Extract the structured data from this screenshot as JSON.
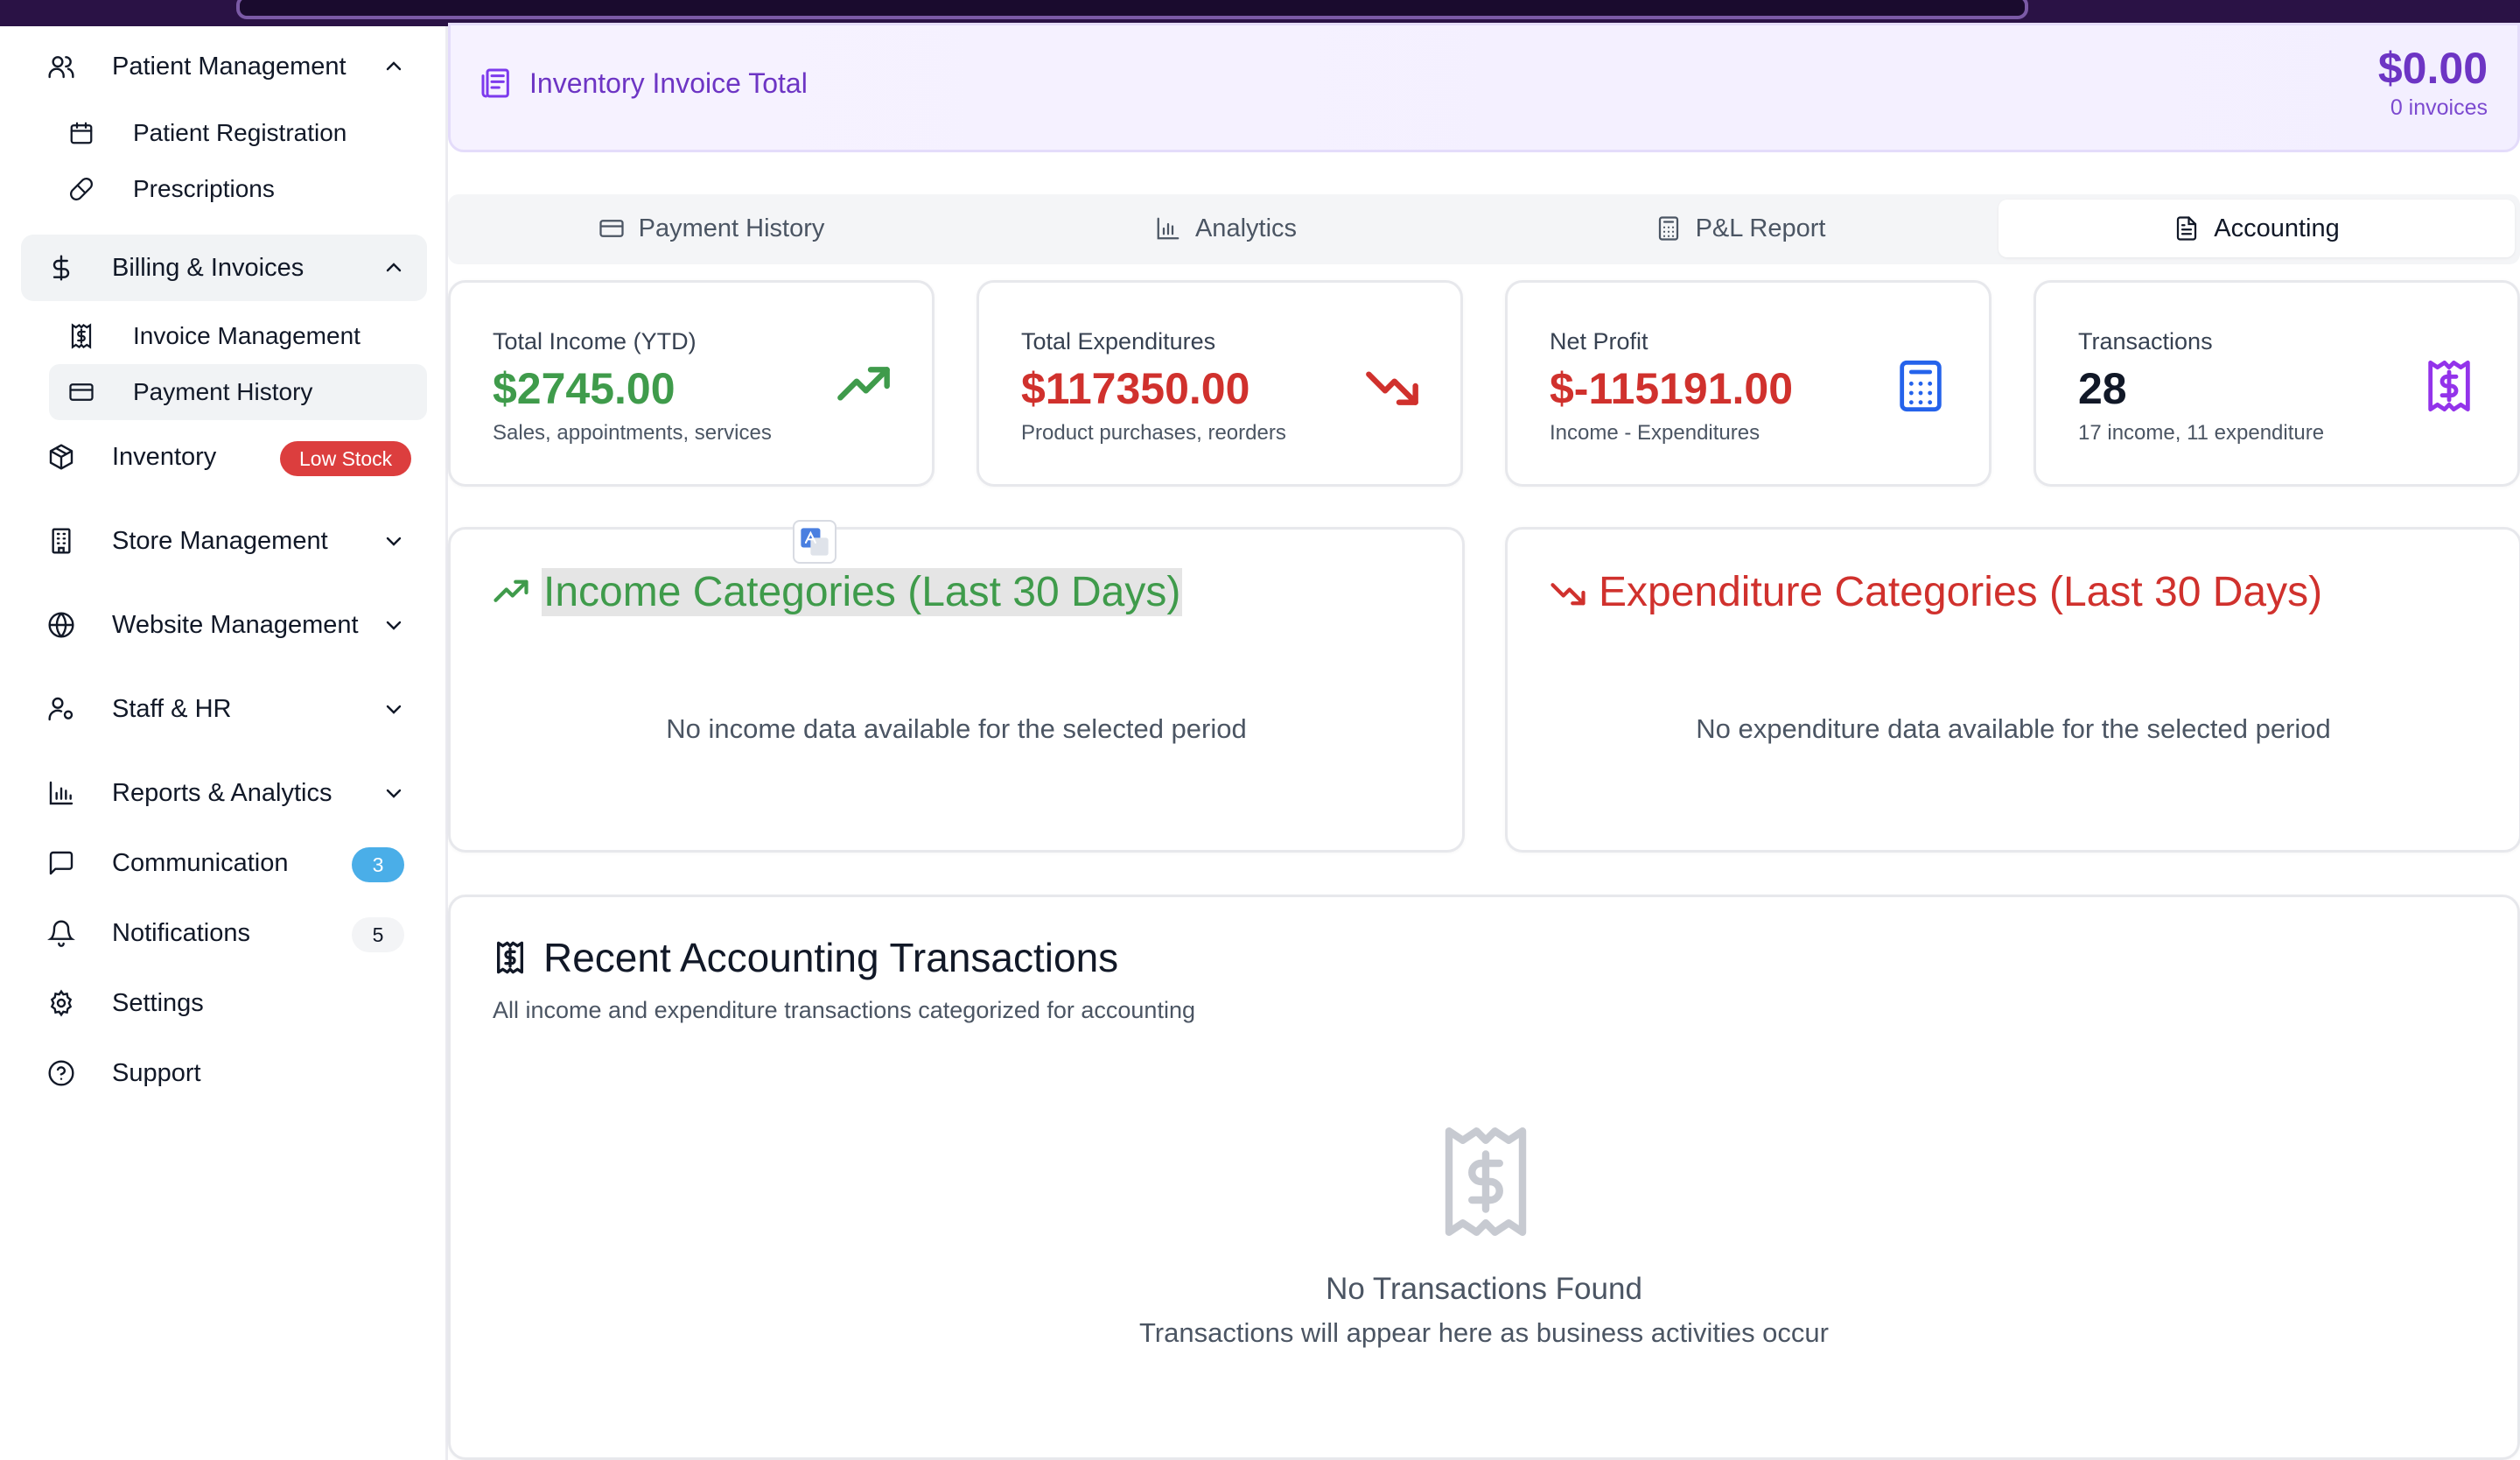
{
  "sidebar": {
    "items": [
      {
        "label": "Patient Management",
        "icon": "users-icon"
      },
      {
        "label": "Patient Registration",
        "icon": "calendar-icon"
      },
      {
        "label": "Prescriptions",
        "icon": "pill-icon"
      },
      {
        "label": "Billing & Invoices",
        "icon": "dollar-icon"
      },
      {
        "label": "Invoice Management",
        "icon": "receipt-icon"
      },
      {
        "label": "Payment History",
        "icon": "credit-card-icon"
      },
      {
        "label": "Inventory",
        "icon": "package-icon",
        "badge": "Low Stock"
      },
      {
        "label": "Store Management",
        "icon": "building-icon"
      },
      {
        "label": "Website Management",
        "icon": "globe-icon"
      },
      {
        "label": "Staff & HR",
        "icon": "user-cog-icon"
      },
      {
        "label": "Reports & Analytics",
        "icon": "bar-chart-icon"
      },
      {
        "label": "Communication",
        "icon": "message-icon",
        "badge": "3"
      },
      {
        "label": "Notifications",
        "icon": "bell-icon",
        "badge": "5"
      },
      {
        "label": "Settings",
        "icon": "gear-icon"
      },
      {
        "label": "Support",
        "icon": "help-circle-icon"
      }
    ]
  },
  "inventory_banner": {
    "title": "Inventory Invoice Total",
    "amount": "$0.00",
    "count": "0 invoices"
  },
  "tabs": [
    {
      "label": "Payment History",
      "icon": "credit-card-icon"
    },
    {
      "label": "Analytics",
      "icon": "bar-chart-icon"
    },
    {
      "label": "P&L Report",
      "icon": "calculator-icon"
    },
    {
      "label": "Accounting",
      "icon": "file-text-icon",
      "active": true
    }
  ],
  "stats": [
    {
      "label": "Total Income (YTD)",
      "value": "$2745.00",
      "sub": "Sales, appointments, services",
      "icon": "trending-up-icon",
      "color": "#3f9b4b"
    },
    {
      "label": "Total Expenditures",
      "value": "$117350.00",
      "sub": "Product purchases, reorders",
      "icon": "trending-down-icon",
      "color": "#d0312d"
    },
    {
      "label": "Net Profit",
      "value": "$-115191.00",
      "sub": "Income - Expenditures",
      "icon": "calculator-icon",
      "color": "#d0312d"
    },
    {
      "label": "Transactions",
      "value": "28",
      "sub": "17 income, 11 expenditure",
      "icon": "receipt-icon",
      "color": "#111827"
    }
  ],
  "income_categories": {
    "title": "Income Categories (Last 30 Days)",
    "empty": "No income data available for the selected period",
    "color": "#3f9b4b"
  },
  "expenditure_categories": {
    "title": "Expenditure Categories (Last 30 Days)",
    "empty": "No expenditure data available for the selected period",
    "color": "#d0312d"
  },
  "recent": {
    "title": "Recent Accounting Transactions",
    "description": "All income and expenditure transactions categorized for accounting",
    "empty_title": "No Transactions Found",
    "empty_description": "Transactions will appear here as business activities occur"
  }
}
